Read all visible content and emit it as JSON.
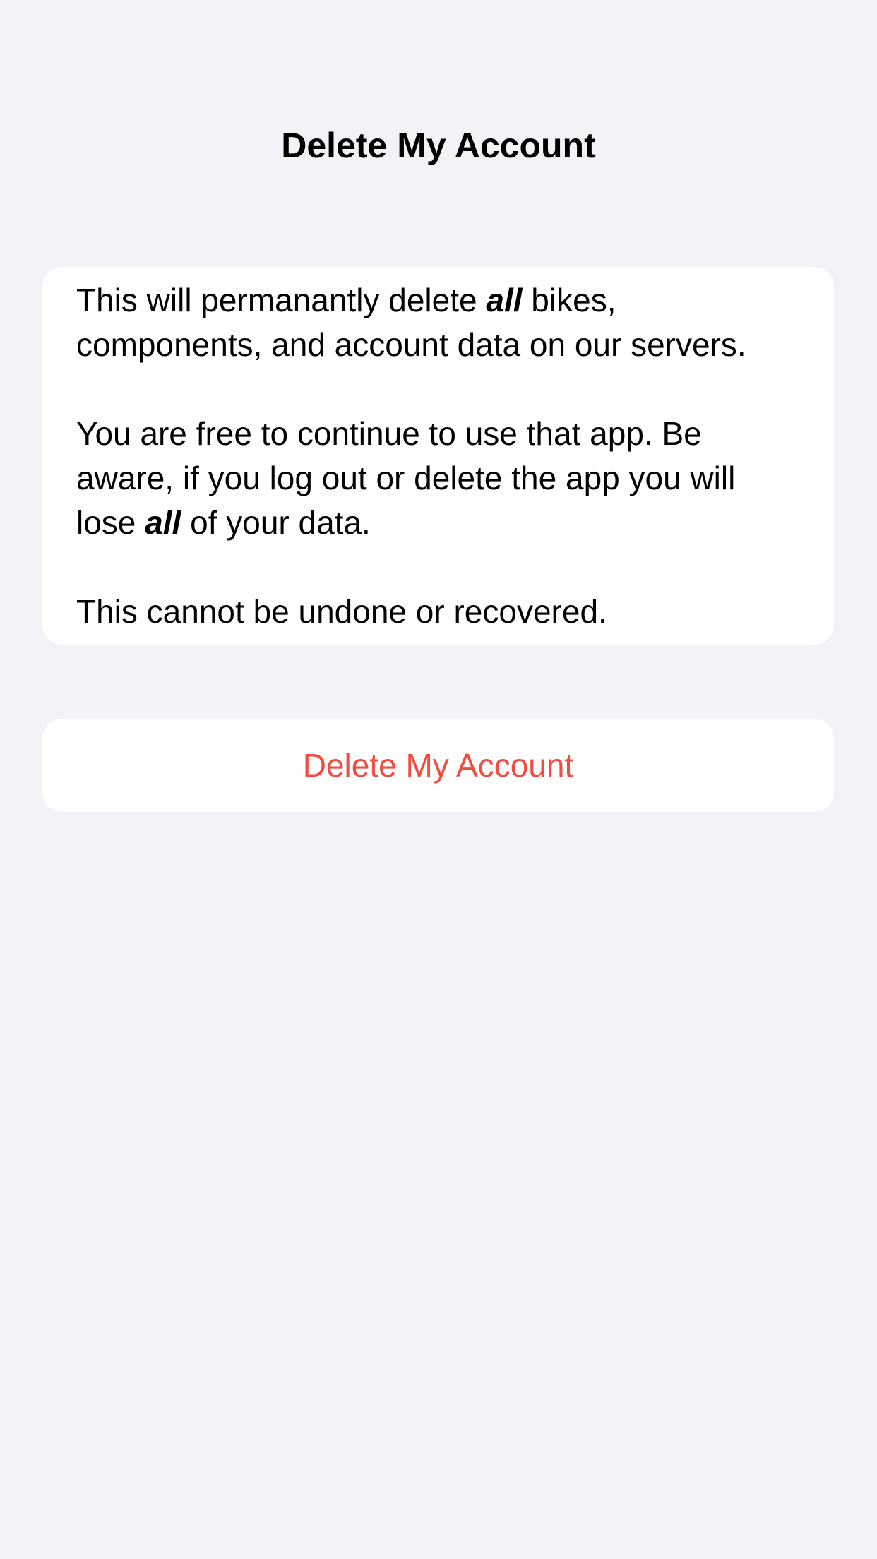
{
  "nav": {
    "title": "Delete My Account"
  },
  "warning": {
    "p1_before": "This will permanantly delete ",
    "p1_emphasis": "all",
    "p1_after": " bikes, components, and account data on our servers.",
    "p2_before": "You are free to continue to use that app. Be aware, if you log out or delete the app you will lose ",
    "p2_emphasis": "all",
    "p2_after": " of your data.",
    "p3": "This cannot be undone or recovered."
  },
  "actions": {
    "delete_label": "Delete My Account"
  },
  "colors": {
    "background": "#f2f2f7",
    "card": "#ffffff",
    "destructive": "#f24b3f"
  }
}
